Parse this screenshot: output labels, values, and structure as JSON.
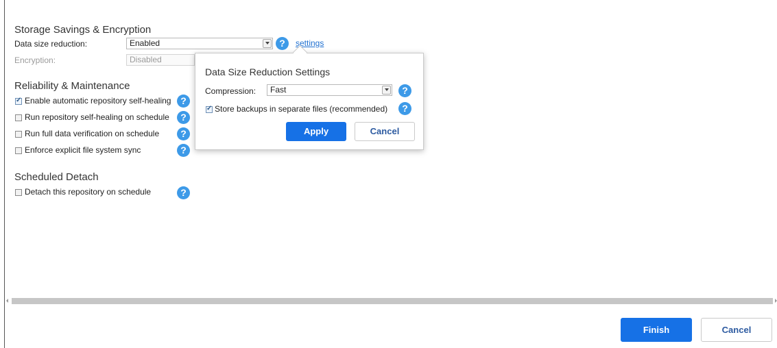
{
  "storage": {
    "heading": "Storage Savings & Encryption",
    "data_size_label": "Data size reduction:",
    "data_size_value": "Enabled",
    "settings_link": "settings",
    "encryption_label": "Encryption:",
    "encryption_value": "Disabled"
  },
  "reliability": {
    "heading": "Reliability & Maintenance",
    "options": [
      {
        "label": "Enable automatic repository self-healing",
        "checked": true
      },
      {
        "label": "Run repository self-healing on schedule",
        "checked": false
      },
      {
        "label": "Run full data verification on schedule",
        "checked": false
      },
      {
        "label": "Enforce explicit file system sync",
        "checked": false
      }
    ]
  },
  "detach": {
    "heading": "Scheduled Detach",
    "option_label": "Detach this repository on schedule",
    "checked": false
  },
  "popover": {
    "title": "Data Size Reduction Settings",
    "compression_label": "Compression:",
    "compression_value": "Fast",
    "store_separate_label": "Store backups in separate files (recommended)",
    "store_separate_checked": true,
    "apply_label": "Apply",
    "cancel_label": "Cancel"
  },
  "footer": {
    "finish_label": "Finish",
    "cancel_label": "Cancel"
  },
  "colors": {
    "primary_button": "#1671e6",
    "help_icon": "#3d9ae8",
    "link": "#1e6fd0"
  }
}
